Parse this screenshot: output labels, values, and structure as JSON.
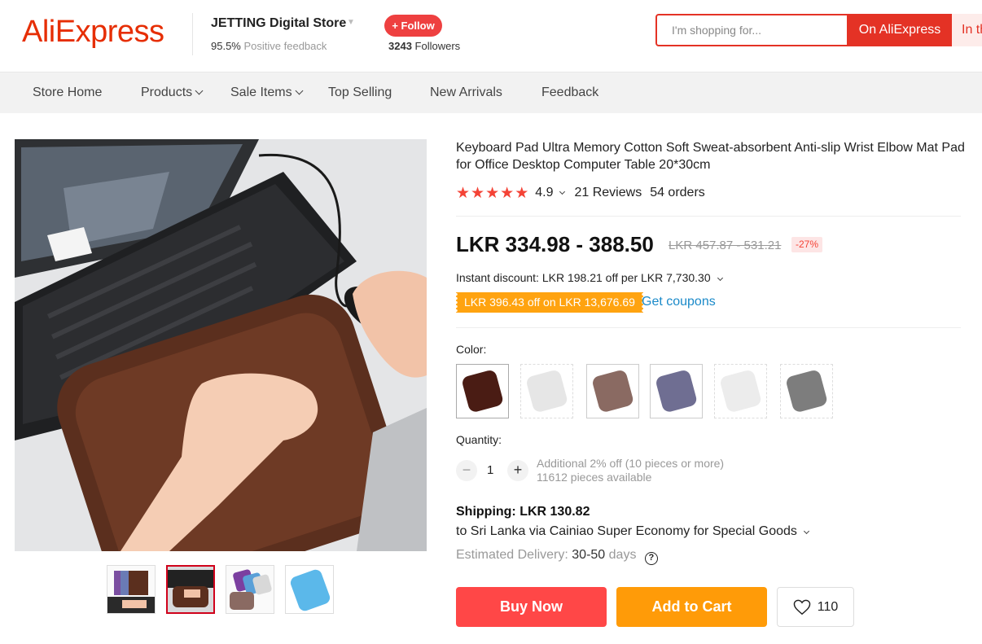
{
  "header": {
    "logo": "AliExpress",
    "store_name": "JETTING Digital Store",
    "feedback_pct": "95.5%",
    "feedback_label": "Positive feedback",
    "follow_label": "+ Follow",
    "followers_count": "3243",
    "followers_label": "Followers",
    "search_placeholder": "I'm shopping for...",
    "search_button": "On AliExpress",
    "search_button2": "In th"
  },
  "nav": {
    "items": [
      "Store Home",
      "Products",
      "Sale Items",
      "Top Selling",
      "New Arrivals",
      "Feedback"
    ]
  },
  "product": {
    "title": "Keyboard Pad Ultra Memory Cotton Soft Sweat-absorbent Anti-slip Wrist Elbow Mat Pad for Office Desktop Computer Table 20*30cm",
    "rating": "4.9",
    "stars": 5,
    "reviews": "21 Reviews",
    "orders": "54 orders",
    "price": "LKR 334.98 - 388.50",
    "old_price": "LKR 457.87 - 531.21",
    "discount_badge": "-27%",
    "instant_discount": "Instant discount: LKR 198.21 off per LKR 7,730.30",
    "coupon": "LKR 396.43 off on LKR 13,676.69",
    "get_coupons": "Get coupons",
    "color_label": "Color:",
    "swatch_colors": [
      "#4a1c14",
      "#e6e6e6",
      "#8a6a62",
      "#6f6e92",
      "#ececec",
      "#7d7d7d"
    ],
    "quantity_label": "Quantity:",
    "quantity": "1",
    "qty_minus": "−",
    "qty_plus": "+",
    "qty_note1": "Additional 2% off (10 pieces or more)",
    "qty_note2": "11612 pieces available",
    "shipping_title": "Shipping: LKR 130.82",
    "shipping_to": "to Sri Lanka via Cainiao Super Economy for Special Goods",
    "est_label": "Estimated Delivery:",
    "est_days": "30-50",
    "est_unit": "days",
    "buy_now": "Buy Now",
    "add_to_cart": "Add to Cart",
    "wishlist_count": "110"
  },
  "colors": {
    "brand": "#e62e04",
    "buy": "#ff4747",
    "cart": "#ff9b08",
    "coupon": "#ffa310",
    "link": "#1b8ac9",
    "star": "#f44336"
  }
}
